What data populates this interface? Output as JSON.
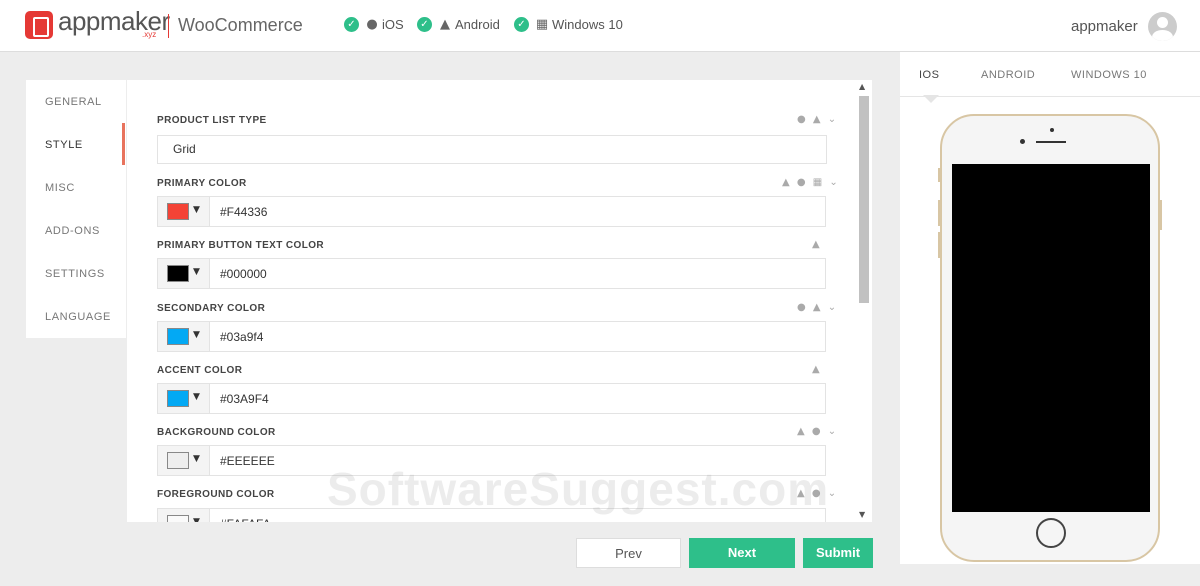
{
  "header": {
    "logo_text": "appmaker",
    "logo_sub": ".xyz",
    "platform_name": "WooCommerce",
    "platforms": [
      {
        "label": "iOS",
        "icon": "apple-icon"
      },
      {
        "label": "Android",
        "icon": "android-icon"
      },
      {
        "label": "Windows 10",
        "icon": "windows-icon"
      }
    ],
    "username": "appmaker"
  },
  "sidebar": {
    "items": [
      {
        "label": "GENERAL"
      },
      {
        "label": "STYLE",
        "active": true
      },
      {
        "label": "MISC"
      },
      {
        "label": "ADD-ONS"
      },
      {
        "label": "SETTINGS"
      },
      {
        "label": "LANGUAGE"
      }
    ]
  },
  "form": {
    "product_list_type": {
      "label": "PRODUCT LIST TYPE",
      "value": "Grid"
    },
    "fields": [
      {
        "label": "PRIMARY COLOR",
        "value": "#F44336",
        "swatch": "#F44336"
      },
      {
        "label": "PRIMARY BUTTON TEXT COLOR",
        "value": "#000000",
        "swatch": "#000000"
      },
      {
        "label": "SECONDARY COLOR",
        "value": "#03a9f4",
        "swatch": "#03a9f4"
      },
      {
        "label": "ACCENT COLOR",
        "value": "#03A9F4",
        "swatch": "#03A9F4"
      },
      {
        "label": "BACKGROUND COLOR",
        "value": "#EEEEEE",
        "swatch": "#EEEEEE"
      },
      {
        "label": "FOREGROUND COLOR",
        "value": "#FAFAFA",
        "swatch": "#FAFAFA"
      }
    ]
  },
  "buttons": {
    "prev": "Prev",
    "next": "Next",
    "submit": "Submit"
  },
  "preview": {
    "tabs": [
      "IOS",
      "ANDROID",
      "WINDOWS 10"
    ],
    "active_tab": "IOS"
  },
  "watermark": "SoftwareSuggest.com",
  "colors": {
    "accent": "#2ebf8a",
    "brand": "#e53935",
    "active_marker": "#e8735d"
  }
}
